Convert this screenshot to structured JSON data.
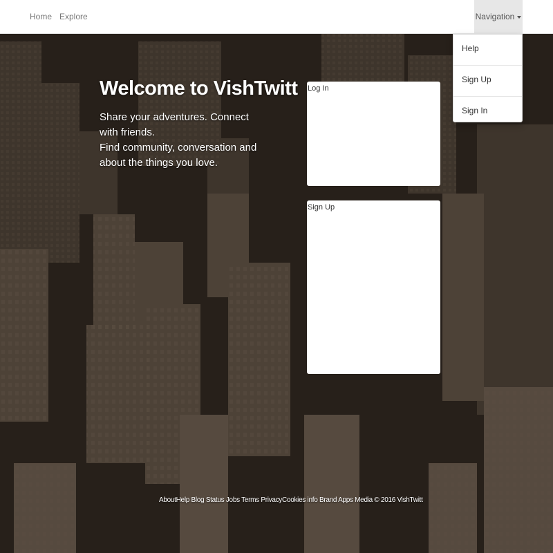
{
  "navbar": {
    "home_label": "Home",
    "explore_label": "Explore",
    "dropdown_label": "Navigation",
    "dropdown_items": [
      "Help",
      "Sign Up",
      "Sign In"
    ]
  },
  "hero": {
    "title": "Welcome to VishTwitt",
    "line1": "Share your adventures. Connect with friends.",
    "line2": "Find community, conversation and about the things you love."
  },
  "login_panel": {
    "title": "Log In"
  },
  "signup_panel": {
    "title": "Sign Up"
  },
  "footer": {
    "links": [
      "About",
      "Help",
      "Blog",
      "Status",
      "Jobs",
      "Terms",
      "Privacy",
      "Cookies",
      "info",
      "Brand",
      "Apps",
      "Media"
    ],
    "copyright": "© 2016 VishTwitt"
  },
  "colors": {
    "navbar_bg": "#ffffff",
    "nav_text": "#777777",
    "background": "#2a231d"
  }
}
